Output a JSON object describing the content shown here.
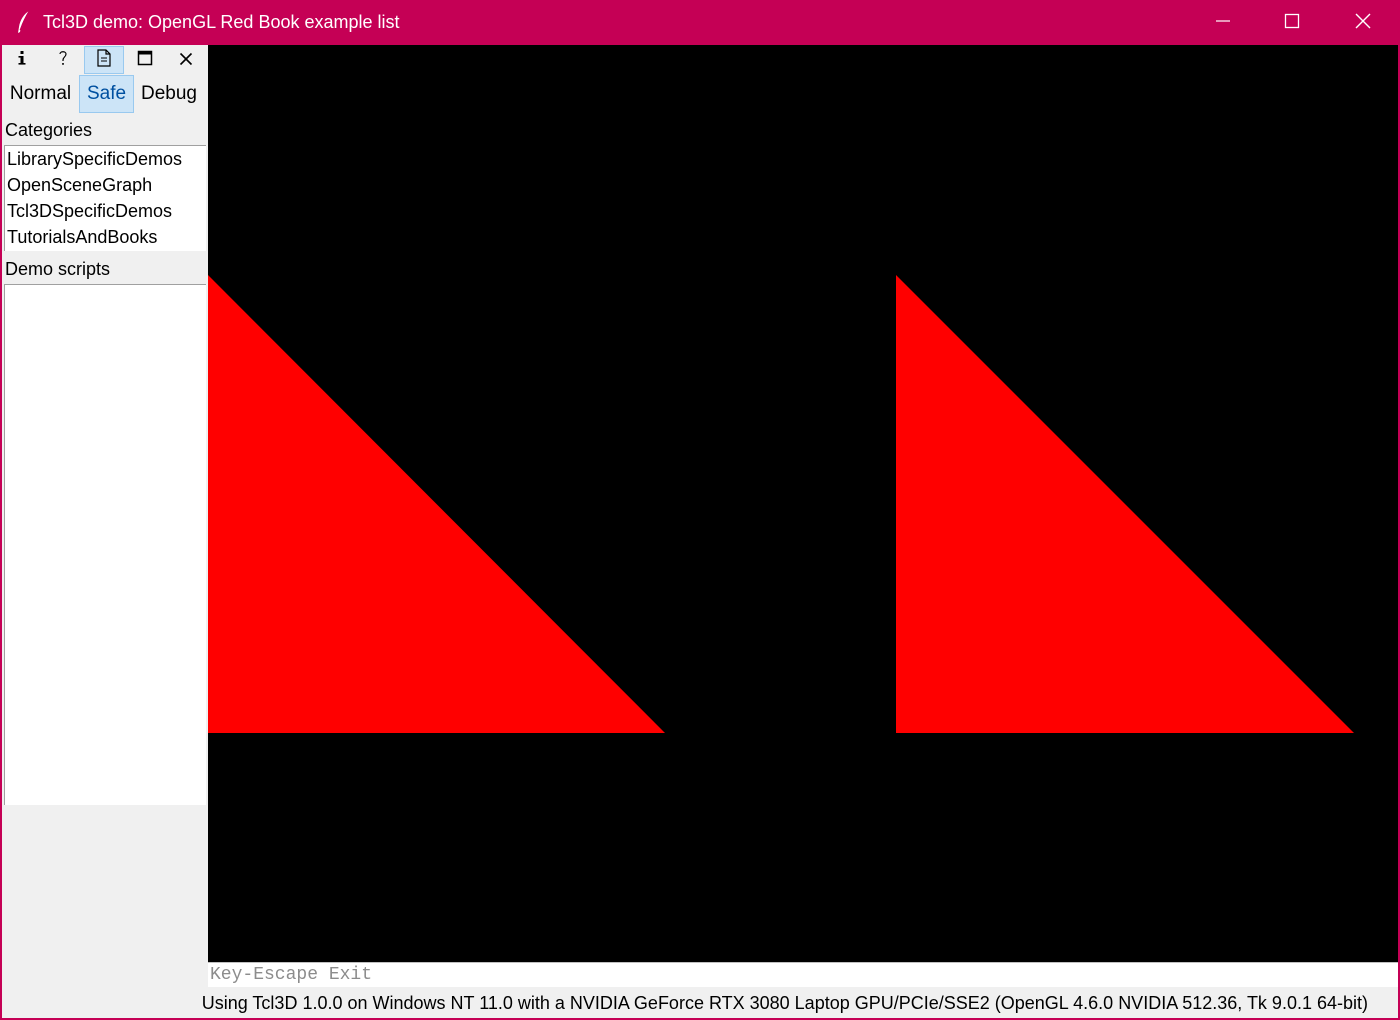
{
  "window": {
    "title": "Tcl3D demo: OpenGL Red Book example list",
    "accent_color": "#c50055"
  },
  "toolbar": {
    "icons": [
      "info-icon",
      "help-icon",
      "document-icon",
      "maximize-icon",
      "close-icon"
    ],
    "active_icon": "document-icon"
  },
  "modes": {
    "items": [
      "Normal",
      "Safe",
      "Debug"
    ],
    "selected": "Safe"
  },
  "categories": {
    "label": "Categories",
    "items": [
      "LibrarySpecificDemos",
      "OpenSceneGraph",
      "Tcl3DSpecificDemos",
      "TutorialsAndBooks"
    ]
  },
  "scripts": {
    "label": "Demo scripts",
    "items": []
  },
  "canvas": {
    "background": "#000000",
    "shape_color": "#ff0000"
  },
  "keyhint": "Key-Escape Exit",
  "status": "Using Tcl3D 1.0.0 on Windows NT 11.0 with a NVIDIA GeForce RTX 3080 Laptop GPU/PCIe/SSE2 (OpenGL 4.6.0 NVIDIA 512.36, Tk 9.0.1 64-bit)"
}
